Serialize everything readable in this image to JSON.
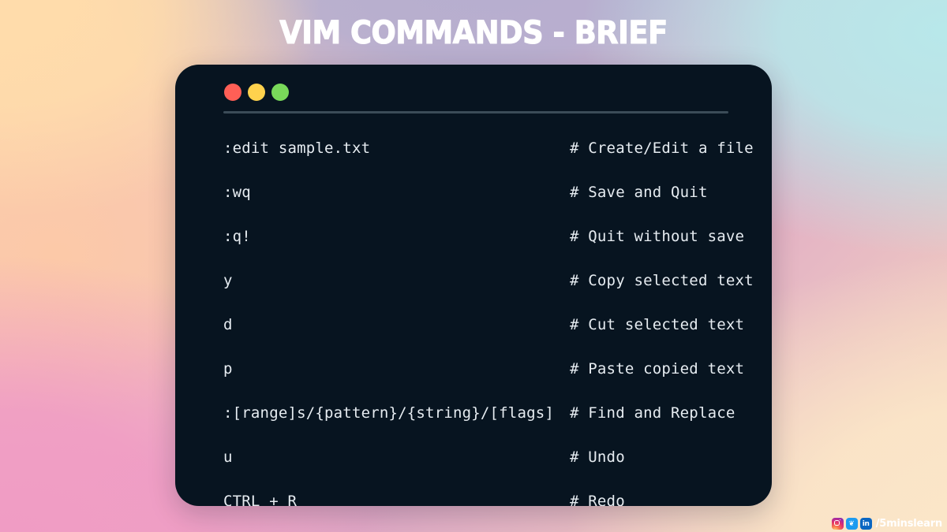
{
  "poster": {
    "title": "VIM COMMANDS - BRIEF",
    "background_colors": {
      "peach": "#ffdcab",
      "lavender": "#b5aecf",
      "cyan": "#b8e8ea",
      "pink": "#f09cc4",
      "cream": "#fbe6c8"
    }
  },
  "terminal": {
    "background_color": "#071420",
    "text_color": "#e6ecf1",
    "divider_color": "#3b4c58",
    "traffic_lights": [
      {
        "name": "close-dot",
        "color": "#ff5f56"
      },
      {
        "name": "minimize-dot",
        "color": "#ffd24d"
      },
      {
        "name": "maximize-dot",
        "color": "#79d95a"
      }
    ],
    "commands": [
      {
        "key": ":edit sample.txt",
        "desc": "# Create/Edit a file"
      },
      {
        "key": ":wq",
        "desc": "# Save and Quit"
      },
      {
        "key": ":q!",
        "desc": "# Quit without save"
      },
      {
        "key": "y",
        "desc": "# Copy selected text"
      },
      {
        "key": "d",
        "desc": "# Cut selected text"
      },
      {
        "key": "p",
        "desc": "# Paste copied text"
      },
      {
        "key": ":[range]s/{pattern}/{string}/[flags]",
        "desc": "# Find and Replace"
      },
      {
        "key": "u",
        "desc": "# Undo"
      },
      {
        "key": "CTRL + R",
        "desc": "# Redo"
      }
    ]
  },
  "watermark": {
    "handle": "/5minslearn",
    "icons": [
      {
        "name": "instagram-icon",
        "glyph": ""
      },
      {
        "name": "twitter-icon",
        "glyph": "❦"
      },
      {
        "name": "linkedin-icon",
        "glyph": "in"
      }
    ]
  }
}
